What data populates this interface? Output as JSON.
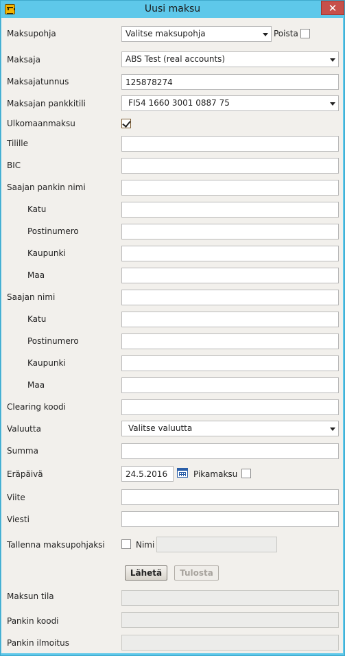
{
  "window": {
    "title": "Uusi maksu",
    "close_glyph": "✕",
    "app_icon": "bank-icon"
  },
  "form": {
    "template": {
      "label": "Maksupohja",
      "value": "Valitse maksupohja",
      "delete_label": "Poista",
      "delete_checked": false
    },
    "payer": {
      "label": "Maksaja",
      "value": "ABS Test (real accounts)"
    },
    "payer_id": {
      "label": "Maksajatunnus",
      "value": "125878274"
    },
    "payer_account": {
      "label": "Maksajan pankkitili",
      "value": "FI54 1660 3001 0887 75"
    },
    "foreign": {
      "label": "Ulkomaanmaksu",
      "checked": true
    },
    "account": {
      "label": "Tilille",
      "value": ""
    },
    "bic": {
      "label": "BIC",
      "value": ""
    },
    "bank_name": {
      "label": "Saajan pankin nimi",
      "value": ""
    },
    "bank_street": {
      "label": "Katu",
      "value": ""
    },
    "bank_postal": {
      "label": "Postinumero",
      "value": ""
    },
    "bank_city": {
      "label": "Kaupunki",
      "value": ""
    },
    "bank_country": {
      "label": "Maa",
      "value": ""
    },
    "recipient_name": {
      "label": "Saajan nimi",
      "value": ""
    },
    "rec_street": {
      "label": "Katu",
      "value": ""
    },
    "rec_postal": {
      "label": "Postinumero",
      "value": ""
    },
    "rec_city": {
      "label": "Kaupunki",
      "value": ""
    },
    "rec_country": {
      "label": "Maa",
      "value": ""
    },
    "clearing": {
      "label": "Clearing koodi",
      "value": ""
    },
    "currency": {
      "label": "Valuutta",
      "value": "Valitse valuutta"
    },
    "amount": {
      "label": "Summa",
      "value": ""
    },
    "due_date": {
      "label": "Eräpäivä",
      "value": "24.5.2016",
      "express_label": "Pikamaksu",
      "express_checked": false
    },
    "reference": {
      "label": "Viite",
      "value": ""
    },
    "message": {
      "label": "Viesti",
      "value": ""
    },
    "save_template": {
      "label": "Tallenna maksupohjaksi",
      "checked": false,
      "name_label": "Nimi",
      "name_value": ""
    }
  },
  "buttons": {
    "send": "Lähetä",
    "print": "Tulosta"
  },
  "status": {
    "state": {
      "label": "Maksun tila",
      "value": ""
    },
    "bank_code": {
      "label": "Pankin koodi",
      "value": ""
    },
    "bank_notice": {
      "label": "Pankin ilmoitus",
      "value": ""
    }
  }
}
